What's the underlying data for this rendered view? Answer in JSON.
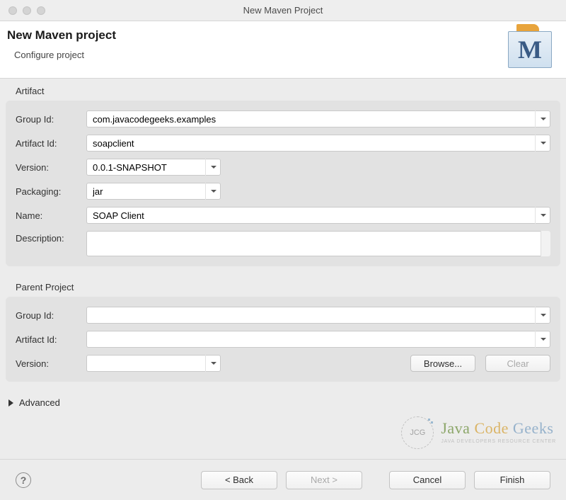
{
  "window": {
    "title": "New Maven Project"
  },
  "header": {
    "title": "New Maven project",
    "subtitle": "Configure project",
    "icon_letter": "M"
  },
  "artifact": {
    "section_label": "Artifact",
    "labels": {
      "group_id": "Group Id:",
      "artifact_id": "Artifact Id:",
      "version": "Version:",
      "packaging": "Packaging:",
      "name": "Name:",
      "description": "Description:"
    },
    "values": {
      "group_id": "com.javacodegeeks.examples",
      "artifact_id": "soapclient",
      "version": "0.0.1-SNAPSHOT",
      "packaging": "jar",
      "name": "SOAP Client",
      "description": ""
    }
  },
  "parent": {
    "section_label": "Parent Project",
    "labels": {
      "group_id": "Group Id:",
      "artifact_id": "Artifact Id:",
      "version": "Version:"
    },
    "values": {
      "group_id": "",
      "artifact_id": "",
      "version": ""
    },
    "buttons": {
      "browse": "Browse...",
      "clear": "Clear"
    }
  },
  "advanced": {
    "label": "Advanced"
  },
  "watermark": {
    "logo": "JCG",
    "java": "Java",
    "code": "Code",
    "geeks": "Geeks",
    "sub": "JAVA DEVELOPERS RESOURCE CENTER"
  },
  "footer": {
    "back": "< Back",
    "next": "Next >",
    "cancel": "Cancel",
    "finish": "Finish"
  }
}
